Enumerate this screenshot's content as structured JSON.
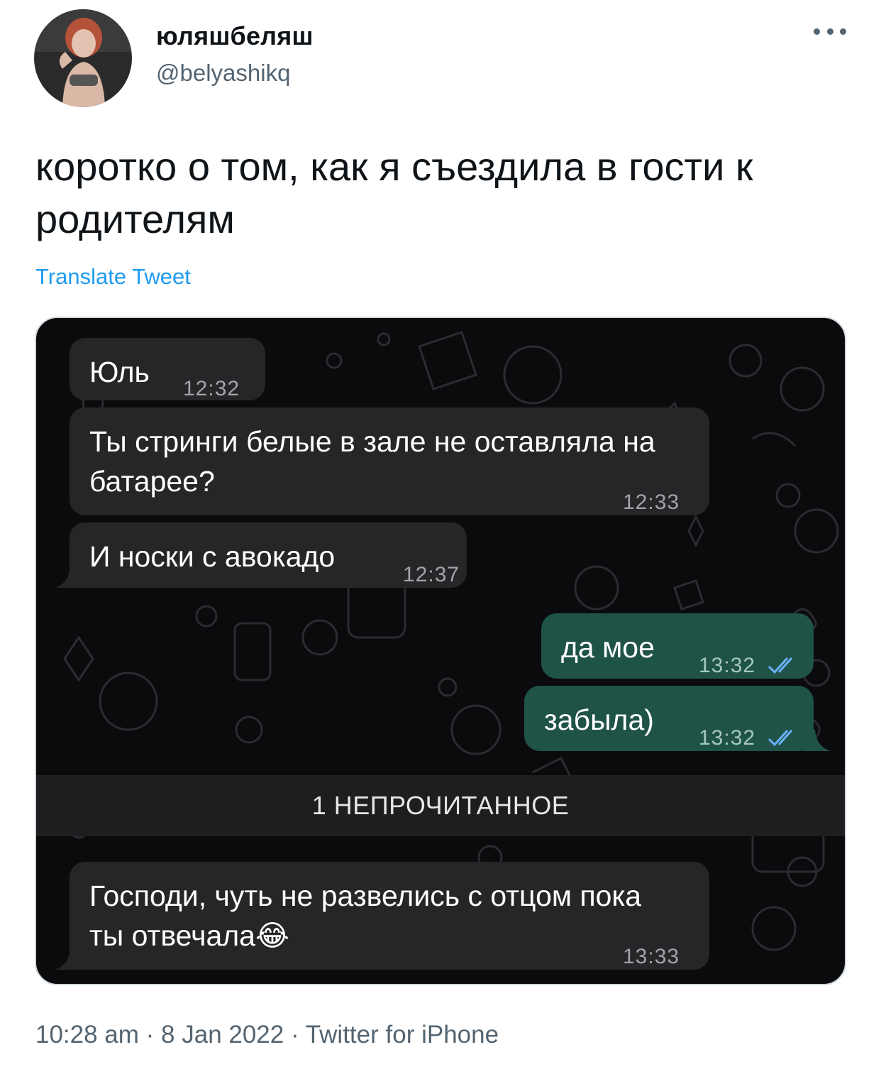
{
  "author": {
    "display_name": "юляшбеляш",
    "handle": "@belyashikq",
    "avatar_icon": "profile-photo"
  },
  "tweet": {
    "text": "коротко о том, как я съездила в гости к родителям",
    "translate_label": "Translate Tweet"
  },
  "chat": {
    "messages": [
      {
        "dir": "in",
        "text": "Юль",
        "time": "12:32"
      },
      {
        "dir": "in",
        "text": "Ты стринги белые в зале не оставляла на батарее?",
        "time": "12:33"
      },
      {
        "dir": "in",
        "text": "И носки с авокадо",
        "time": "12:37"
      },
      {
        "dir": "out",
        "text": "да мое",
        "time": "13:32"
      },
      {
        "dir": "out",
        "text": "забыла)",
        "time": "13:32"
      },
      {
        "dir": "in",
        "text": "Господи, чуть не развелись с отцом пока ты отвечала😂",
        "time": "13:33"
      }
    ],
    "unread_banner": "1 НЕПРОЧИТАННОЕ",
    "colors": {
      "incoming": "#262628",
      "outgoing": "#1f5347",
      "read_ticks": "#6ab2ff"
    }
  },
  "footer": {
    "meta": "10:28 am · 8 Jan 2022 · Twitter for iPhone"
  }
}
